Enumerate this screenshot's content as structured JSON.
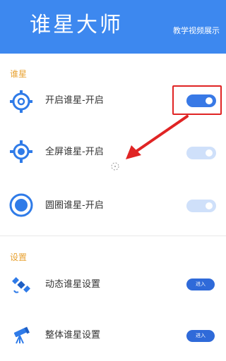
{
  "header": {
    "title": "谁星大师",
    "tutorial_link": "教学视频展示"
  },
  "sections": {
    "aim_label": "谁星",
    "settings_label": "设置"
  },
  "aim_rows": [
    {
      "label": "开启谁星-开启",
      "icon": "crosshair-ring-icon",
      "toggle_on": true
    },
    {
      "label": "全屏谁星-开启",
      "icon": "crosshair-target-icon",
      "toggle_on": false
    },
    {
      "label": "圆圈谁星-开启",
      "icon": "circle-dot-icon",
      "toggle_on": false
    }
  ],
  "settings_rows": [
    {
      "label": "动态谁星设置",
      "icon": "satellite-icon",
      "button": "进入"
    },
    {
      "label": "整体谁星设置",
      "icon": "telescope-icon",
      "button": "进入"
    }
  ],
  "colors": {
    "header_bg": "#3d88ef",
    "section_label": "#e8a232",
    "toggle_on": "#3879e6",
    "toggle_off": "#cfe0fa",
    "icon_blue": "#2f7be8",
    "annotation_red": "#e02424"
  }
}
